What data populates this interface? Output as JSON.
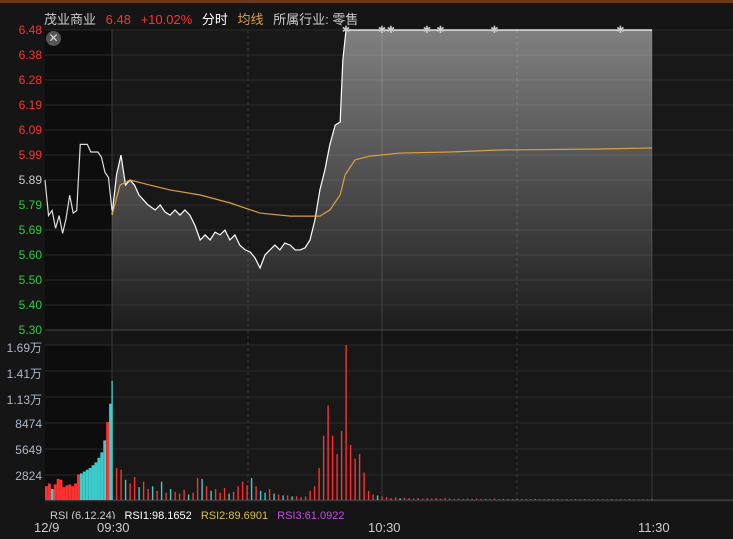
{
  "header": {
    "name": "茂业商业",
    "price": "6.48",
    "change": "+10.02%",
    "mode": "分时",
    "avg_label": "均线",
    "industry": "所属行业: 零售"
  },
  "colors": {
    "up": "#ff3030",
    "down": "#3ecbcb",
    "avg": "#d9a040",
    "price_line": "#ffffff"
  },
  "price_axis": [
    {
      "v": "6.48",
      "c": "#ff3030"
    },
    {
      "v": "6.38",
      "c": "#ff3030"
    },
    {
      "v": "6.28",
      "c": "#ff3030"
    },
    {
      "v": "6.19",
      "c": "#ff3030"
    },
    {
      "v": "6.09",
      "c": "#ff3030"
    },
    {
      "v": "5.99",
      "c": "#ff3030"
    },
    {
      "v": "5.89",
      "c": "#cccccc"
    },
    {
      "v": "5.79",
      "c": "#2ecc40"
    },
    {
      "v": "5.69",
      "c": "#2ecc40"
    },
    {
      "v": "5.60",
      "c": "#2ecc40"
    },
    {
      "v": "5.50",
      "c": "#2ecc40"
    },
    {
      "v": "5.40",
      "c": "#2ecc40"
    },
    {
      "v": "5.30",
      "c": "#2ecc40"
    }
  ],
  "volume_axis": [
    "1.69万",
    "1.41万",
    "1.13万",
    "8474",
    "5649",
    "2824"
  ],
  "rsi": {
    "title": "RSI (6,12,24)",
    "rsi1": "RSI1:98.1652",
    "rsi2": "RSI2:89.6901",
    "rsi3": "RSI3:61.0922"
  },
  "time_axis": {
    "date": "12/9",
    "t1": "09:30",
    "t2": "10:30",
    "t3": "11:30"
  },
  "chart_data": {
    "type": "line",
    "ylim": [
      5.3,
      6.48
    ],
    "volume_max": 16900,
    "premarket_price": [
      5.89,
      5.75,
      5.77,
      5.7,
      5.75,
      5.68,
      5.74,
      5.83,
      5.76,
      5.77,
      6.03,
      6.03,
      6.03,
      6.0,
      6.0,
      6.0,
      5.98,
      5.92,
      5.9,
      5.77
    ],
    "price": [
      [
        0,
        5.752
      ],
      [
        1,
        5.91
      ],
      [
        2,
        5.988
      ],
      [
        3,
        5.87
      ],
      [
        4,
        5.89
      ],
      [
        5,
        5.87
      ],
      [
        6,
        5.831
      ],
      [
        8,
        5.792
      ],
      [
        9.6,
        5.772
      ],
      [
        10.7,
        5.792
      ],
      [
        11.8,
        5.764
      ],
      [
        12.9,
        5.752
      ],
      [
        14,
        5.772
      ],
      [
        15.1,
        5.752
      ],
      [
        16.2,
        5.772
      ],
      [
        17.3,
        5.752
      ],
      [
        18.4,
        5.713
      ],
      [
        19.6,
        5.654
      ],
      [
        20.7,
        5.674
      ],
      [
        21.8,
        5.654
      ],
      [
        22.9,
        5.685
      ],
      [
        24,
        5.674
      ],
      [
        25.1,
        5.693
      ],
      [
        26.2,
        5.654
      ],
      [
        27.3,
        5.674
      ],
      [
        28.4,
        5.634
      ],
      [
        29.6,
        5.615
      ],
      [
        30.7,
        5.607
      ],
      [
        31.8,
        5.583
      ],
      [
        32.9,
        5.544
      ],
      [
        34,
        5.595
      ],
      [
        35.1,
        5.615
      ],
      [
        36.2,
        5.634
      ],
      [
        37.3,
        5.615
      ],
      [
        38.4,
        5.642
      ],
      [
        39.6,
        5.634
      ],
      [
        40.7,
        5.615
      ],
      [
        41.8,
        5.615
      ],
      [
        42.9,
        5.623
      ],
      [
        44,
        5.654
      ],
      [
        45.1,
        5.733
      ],
      [
        46.2,
        5.851
      ],
      [
        47.3,
        5.929
      ],
      [
        48.4,
        6.028
      ],
      [
        49.6,
        6.106
      ],
      [
        50.7,
        6.118
      ],
      [
        51.3,
        6.362
      ],
      [
        52,
        6.48
      ],
      [
        120,
        6.48
      ]
    ],
    "avg": [
      [
        0,
        5.752
      ],
      [
        1.8,
        5.87
      ],
      [
        4,
        5.89
      ],
      [
        8.4,
        5.87
      ],
      [
        12.9,
        5.851
      ],
      [
        19.6,
        5.831
      ],
      [
        26.2,
        5.8
      ],
      [
        32.9,
        5.76
      ],
      [
        39.6,
        5.748
      ],
      [
        46.2,
        5.748
      ],
      [
        48.4,
        5.772
      ],
      [
        50.7,
        5.831
      ],
      [
        51.8,
        5.91
      ],
      [
        54,
        5.969
      ],
      [
        57.3,
        5.984
      ],
      [
        64,
        5.996
      ],
      [
        75.1,
        6.0
      ],
      [
        86.2,
        6.008
      ],
      [
        108.4,
        6.012
      ],
      [
        120,
        6.016
      ]
    ],
    "limit_markers": [
      52,
      60,
      62,
      70,
      73,
      85,
      113
    ],
    "premarket_volume": [
      [
        1500,
        "r"
      ],
      [
        1800,
        "r"
      ],
      [
        1200,
        "c"
      ],
      [
        1700,
        "r"
      ],
      [
        2300,
        "r"
      ],
      [
        2200,
        "r"
      ],
      [
        1400,
        "r"
      ],
      [
        1600,
        "r"
      ],
      [
        1700,
        "r"
      ],
      [
        1500,
        "r"
      ],
      [
        1800,
        "r"
      ],
      [
        2800,
        "r"
      ],
      [
        2900,
        "c"
      ],
      [
        3100,
        "c"
      ],
      [
        3300,
        "c"
      ],
      [
        3500,
        "c"
      ],
      [
        3800,
        "c"
      ],
      [
        4100,
        "c"
      ],
      [
        4600,
        "c"
      ],
      [
        5200,
        "c"
      ],
      [
        6500,
        "c"
      ],
      [
        8500,
        "r"
      ],
      [
        10500,
        "c"
      ]
    ],
    "volume": [
      [
        13000,
        "c"
      ],
      [
        3500,
        "r"
      ],
      [
        3300,
        "r"
      ],
      [
        2200,
        "c"
      ],
      [
        1800,
        "r"
      ],
      [
        2500,
        "r"
      ],
      [
        1400,
        "c"
      ],
      [
        2000,
        "r"
      ],
      [
        1200,
        "r"
      ],
      [
        1500,
        "c"
      ],
      [
        1000,
        "r"
      ],
      [
        2000,
        "c"
      ],
      [
        800,
        "r"
      ],
      [
        1200,
        "c"
      ],
      [
        900,
        "r"
      ],
      [
        700,
        "r"
      ],
      [
        1100,
        "r"
      ],
      [
        600,
        "c"
      ],
      [
        800,
        "r"
      ],
      [
        2400,
        "r"
      ],
      [
        2300,
        "c"
      ],
      [
        1500,
        "r"
      ],
      [
        1000,
        "c"
      ],
      [
        1200,
        "r"
      ],
      [
        800,
        "r"
      ],
      [
        1300,
        "r"
      ],
      [
        700,
        "c"
      ],
      [
        900,
        "r"
      ],
      [
        1500,
        "r"
      ],
      [
        2000,
        "r"
      ],
      [
        1600,
        "r"
      ],
      [
        2400,
        "c"
      ],
      [
        1500,
        "r"
      ],
      [
        1000,
        "c"
      ],
      [
        800,
        "c"
      ],
      [
        1200,
        "r"
      ],
      [
        700,
        "c"
      ],
      [
        600,
        "r"
      ],
      [
        500,
        "c"
      ],
      [
        500,
        "r"
      ],
      [
        400,
        "c"
      ],
      [
        400,
        "r"
      ],
      [
        300,
        "r"
      ],
      [
        400,
        "r"
      ],
      [
        1000,
        "r"
      ],
      [
        1500,
        "r"
      ],
      [
        3500,
        "r"
      ],
      [
        7000,
        "r"
      ],
      [
        10300,
        "r"
      ],
      [
        7000,
        "r"
      ],
      [
        5000,
        "r"
      ],
      [
        7500,
        "r"
      ],
      [
        16900,
        "r"
      ],
      [
        6000,
        "r"
      ],
      [
        4500,
        "r"
      ],
      [
        5000,
        "r"
      ],
      [
        3000,
        "r"
      ],
      [
        1000,
        "r"
      ],
      [
        600,
        "r"
      ],
      [
        500,
        "c"
      ],
      [
        400,
        "r"
      ],
      [
        300,
        "r"
      ],
      [
        200,
        "r"
      ],
      [
        300,
        "r"
      ],
      [
        200,
        "c"
      ],
      [
        250,
        "r"
      ],
      [
        200,
        "r"
      ],
      [
        150,
        "r"
      ],
      [
        200,
        "r"
      ],
      [
        150,
        "r"
      ],
      [
        200,
        "r"
      ],
      [
        150,
        "r"
      ],
      [
        200,
        "r"
      ],
      [
        150,
        "r"
      ],
      [
        200,
        "r"
      ],
      [
        150,
        "r"
      ],
      [
        120,
        "r"
      ],
      [
        150,
        "r"
      ],
      [
        120,
        "r"
      ],
      [
        150,
        "r"
      ],
      [
        120,
        "r"
      ],
      [
        150,
        "r"
      ],
      [
        100,
        "r"
      ],
      [
        120,
        "r"
      ],
      [
        100,
        "r"
      ],
      [
        150,
        "r"
      ],
      [
        100,
        "r"
      ],
      [
        120,
        "r"
      ],
      [
        100,
        "r"
      ],
      [
        100,
        "r"
      ],
      [
        120,
        "r"
      ],
      [
        100,
        "r"
      ],
      [
        100,
        "r"
      ],
      [
        100,
        "r"
      ],
      [
        120,
        "r"
      ],
      [
        100,
        "r"
      ],
      [
        100,
        "r"
      ],
      [
        100,
        "r"
      ],
      [
        100,
        "r"
      ],
      [
        100,
        "r"
      ],
      [
        80,
        "r"
      ],
      [
        100,
        "r"
      ],
      [
        80,
        "r"
      ],
      [
        100,
        "r"
      ],
      [
        80,
        "r"
      ],
      [
        100,
        "r"
      ],
      [
        80,
        "r"
      ],
      [
        80,
        "r"
      ],
      [
        100,
        "r"
      ],
      [
        80,
        "r"
      ],
      [
        80,
        "r"
      ],
      [
        100,
        "r"
      ],
      [
        80,
        "r"
      ],
      [
        80,
        "r"
      ],
      [
        80,
        "r"
      ],
      [
        100,
        "r"
      ],
      [
        80,
        "r"
      ],
      [
        80,
        "r"
      ],
      [
        80,
        "r"
      ],
      [
        80,
        "r"
      ],
      [
        100,
        "r"
      ]
    ]
  }
}
